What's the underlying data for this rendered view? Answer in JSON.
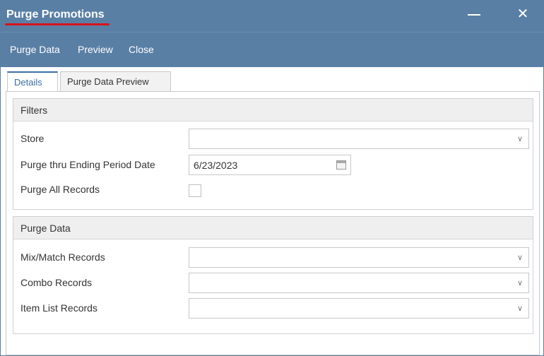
{
  "window": {
    "title": "Purge Promotions",
    "minimize_icon": "minimize-icon",
    "close_icon": "close-icon",
    "close_glyph": "✕"
  },
  "toolbar": {
    "purge_data": "Purge Data",
    "preview": "Preview",
    "close": "Close"
  },
  "tabs": [
    {
      "label": "Details",
      "active": true
    },
    {
      "label": "Purge Data Preview",
      "active": false
    }
  ],
  "filters": {
    "header": "Filters",
    "store_label": "Store",
    "store_value": "",
    "purge_thru_label": "Purge thru Ending Period Date",
    "purge_thru_value": "6/23/2023",
    "purge_all_label": "Purge All Records",
    "purge_all_checked": false
  },
  "purge_data": {
    "header": "Purge Data",
    "mix_match_label": "Mix/Match Records",
    "mix_match_value": "",
    "combo_label": "Combo Records",
    "combo_value": "",
    "item_list_label": "Item List Records",
    "item_list_value": ""
  },
  "colors": {
    "titlebar": "#5a7fa5",
    "accent_underline": "#d9141b",
    "active_tab": "#3b6ea5"
  }
}
